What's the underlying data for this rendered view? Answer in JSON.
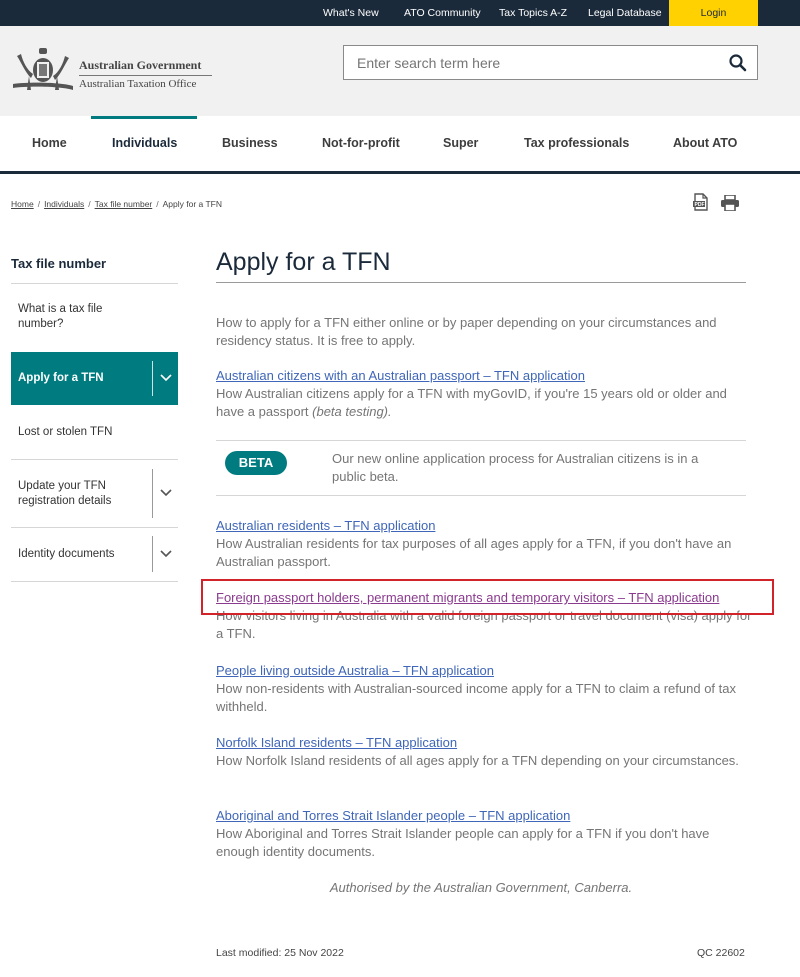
{
  "topbar": {
    "links": [
      "What's New",
      "ATO Community",
      "Tax Topics A-Z",
      "Legal Database"
    ],
    "login": "Login"
  },
  "header": {
    "logo_line1": "Australian Government",
    "logo_line2": "Australian Taxation Office",
    "search_placeholder": "Enter search term here"
  },
  "nav": {
    "items": [
      "Home",
      "Individuals",
      "Business",
      "Not-for-profit",
      "Super",
      "Tax professionals",
      "About ATO"
    ],
    "active": "Individuals"
  },
  "breadcrumb": {
    "items": [
      "Home",
      "Individuals",
      "Tax file number",
      "Apply for a TFN"
    ],
    "separator": "/"
  },
  "sidebar": {
    "title": "Tax file number",
    "items": [
      {
        "label": "What is a tax file number?"
      },
      {
        "label": "Apply for a TFN"
      },
      {
        "label": "Lost or stolen TFN"
      },
      {
        "label": "Update your TFN registration details"
      },
      {
        "label": "Identity documents"
      }
    ]
  },
  "main": {
    "title": "Apply for a TFN",
    "intro": "How to apply for a TFN either online or by paper depending on your circumstances and residency status. It is free to apply.",
    "beta_label": "BETA",
    "beta_text": "Our new online application process for Australian citizens is in a public beta.",
    "entries": [
      {
        "link": "Australian citizens with an Australian passport – TFN application",
        "desc": "How Australian citizens apply for a TFN with myGovID, if you're 15  years old or older and have a passport",
        "desc_italic": "(beta testing)."
      },
      {
        "link": "Australian residents – TFN application",
        "desc": "How Australian residents for tax purposes of all ages apply for a TFN, if you don't have an Australian passport."
      },
      {
        "link": "Foreign passport holders, permanent migrants and temporary visitors – TFN application",
        "desc": "How visitors living in Australia with a valid foreign passport or travel document (visa) apply for a TFN."
      },
      {
        "link": "People living outside Australia – TFN application",
        "desc": "How non-residents with Australian-sourced income apply for a TFN to claim a refund of tax withheld."
      },
      {
        "link": "Norfolk Island residents – TFN application",
        "desc": "How Norfolk Island residents of all ages apply for a TFN depending on your circumstances."
      },
      {
        "link": "Aboriginal and Torres Strait Islander people – TFN application",
        "desc": "How Aboriginal and Torres Strait Islander people can apply for a TFN if you don't have enough identity documents."
      }
    ],
    "authorised": "Authorised by the Australian Government, Canberra.",
    "last_modified": "Last modified: 25 Nov 2022",
    "qc": "QC 22602"
  },
  "colors": {
    "navy": "#1b2a3a",
    "teal": "#007b7f",
    "login_yellow": "#ffd100",
    "link_blue": "#3f66b8",
    "visited_purple": "#8a3b8f",
    "highlight_red": "#d2232a"
  },
  "icons": [
    "coat-of-arms-logo",
    "search-icon",
    "pdf-icon",
    "print-icon",
    "chevron-down-icon"
  ]
}
